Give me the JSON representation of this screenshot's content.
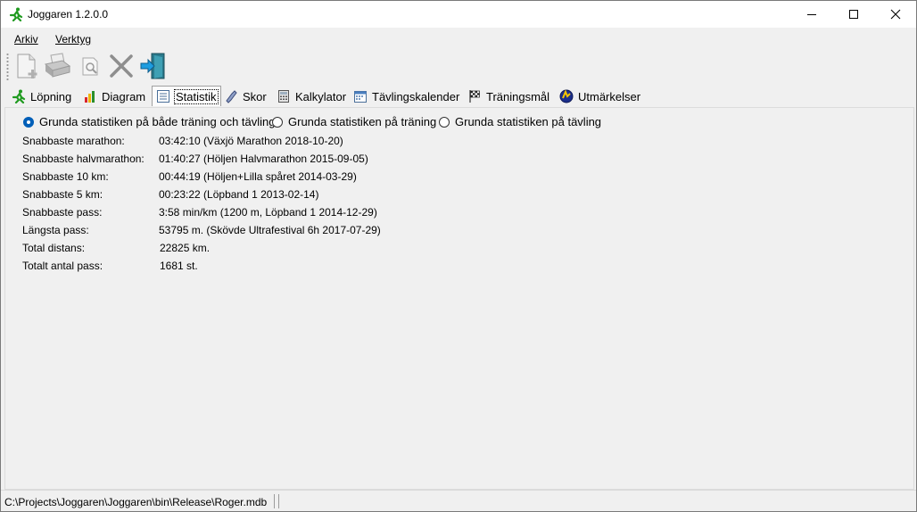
{
  "window": {
    "title": "Joggaren 1.2.0.0"
  },
  "menu": {
    "items": [
      {
        "label": "Arkiv"
      },
      {
        "label": "Verktyg"
      }
    ]
  },
  "toolbar": {
    "buttons": [
      "new-document-icon",
      "print-icon",
      "print-preview-icon",
      "delete-icon",
      "exit-icon"
    ]
  },
  "tabs": [
    {
      "label": "Löpning",
      "icon": "runner-icon"
    },
    {
      "label": "Diagram",
      "icon": "bar-chart-icon"
    },
    {
      "label": "Statistik",
      "icon": "list-icon",
      "active": true
    },
    {
      "label": "Skor",
      "icon": "shoe-icon"
    },
    {
      "label": "Kalkylator",
      "icon": "calculator-icon"
    },
    {
      "label": "Tävlingskalender",
      "icon": "calendar-icon"
    },
    {
      "label": "Träningsmål",
      "icon": "checkered-flag-icon"
    },
    {
      "label": "Utmärkelser",
      "icon": "medal-icon"
    }
  ],
  "stats": {
    "radios": [
      {
        "label": "Grunda statistiken på både träning och tävling",
        "checked": true
      },
      {
        "label": "Grunda statistiken på träning",
        "checked": false
      },
      {
        "label": "Grunda statistiken på tävling",
        "checked": false
      }
    ],
    "rows": [
      {
        "label": "Snabbaste marathon:",
        "value": "03:42:10 (Växjö Marathon 2018-10-20)"
      },
      {
        "label": "Snabbaste halvmarathon:",
        "value": "01:40:27 (Höljen Halvmarathon 2015-09-05)"
      },
      {
        "label": "Snabbaste 10 km:",
        "value": "00:44:19 (Höljen+Lilla spåret 2014-03-29)"
      },
      {
        "label": "Snabbaste 5 km:",
        "value": "00:23:22 (Löpband 1 2013-02-14)"
      },
      {
        "label": "Snabbaste pass:",
        "value": "3:58 min/km (1200 m, Löpband 1 2014-12-29)"
      },
      {
        "label": "Längsta pass:",
        "value": "53795 m. (Skövde Ultrafestival 6h 2017-07-29)"
      },
      {
        "label": "Total distans:",
        "value": "22825 km."
      },
      {
        "label": "Totalt antal pass:",
        "value": "1681 st."
      }
    ]
  },
  "statusbar": {
    "path": "C:\\Projects\\Joggaren\\Joggaren\\bin\\Release\\Roger.mdb"
  },
  "colors": {
    "accent": "#005fb8",
    "window_bg": "#f0f0f0",
    "titlebar_bg": "#ffffff"
  }
}
